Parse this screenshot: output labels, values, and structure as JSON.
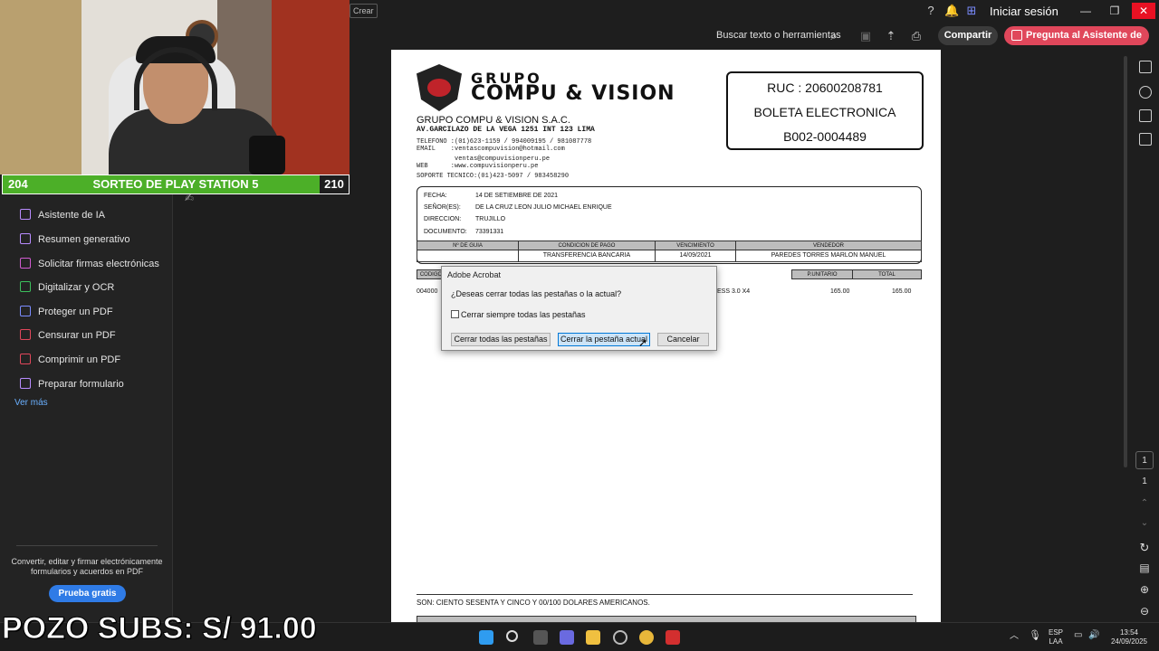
{
  "app": {
    "crear_label": "Crear",
    "signin_label": "Iniciar sesión",
    "search_label": "Buscar texto o herramientas",
    "share_label": "Compartir",
    "ai_button_label": "Pregunta al Asistente de IA",
    "window_controls": {
      "minimize": "—",
      "restore": "❐",
      "close": "✕"
    }
  },
  "stream": {
    "left_number": "204",
    "title": "SORTEO DE PLAY STATION 5",
    "right_number": "210",
    "subs_text": "POZO SUBS: S/ 91.00",
    "accent_color": "#4caf28"
  },
  "sidebar": {
    "items": [
      {
        "label": "Asistente de IA",
        "icon": "ai-assistant-icon",
        "color": "#b98cff"
      },
      {
        "label": "Resumen generativo",
        "icon": "summary-icon",
        "color": "#b98cff"
      },
      {
        "label": "Solicitar firmas electrónicas",
        "icon": "signature-icon",
        "color": "#d05bd0"
      },
      {
        "label": "Digitalizar y OCR",
        "icon": "scan-icon",
        "color": "#3cbf5c"
      },
      {
        "label": "Proteger un PDF",
        "icon": "protect-icon",
        "color": "#7b8cff"
      },
      {
        "label": "Censurar un PDF",
        "icon": "redact-icon",
        "color": "#e0475b"
      },
      {
        "label": "Comprimir un PDF",
        "icon": "compress-icon",
        "color": "#e0475b"
      },
      {
        "label": "Preparar formulario",
        "icon": "form-icon",
        "color": "#b98cff"
      }
    ],
    "more_label": "Ver más",
    "promo_text": "Convertir, editar y firmar electrónicamente formularios y acuerdos en PDF",
    "trial_label": "Prueba gratis"
  },
  "document": {
    "logo_top": "GRUPO",
    "logo_name": "COMPU & VISION",
    "company": "GRUPO COMPU & VISION S.A.C.",
    "address": "AV.GARCILAZO DE LA VEGA 1251 INT 123 LIMA",
    "telefono": "TELEFONO :(01)623-1159 / 994009195 / 981087778",
    "email": "EMAIL    :ventascompuvision@hotmail.com",
    "email2": "          ventas@compuvisionperu.pe",
    "web": "WEB      :www.compuvisionperu.pe",
    "soporte": "SOPORTE TECNICO:(01)423-5097 / 983458290",
    "ruc": "RUC : 20600208781",
    "doc_type": "BOLETA ELECTRONICA",
    "doc_number": "B002-0004489",
    "fields": [
      {
        "label": "FECHA:",
        "value": "14 DE SETIEMBRE DE 2021"
      },
      {
        "label": "SEÑOR(ES):",
        "value": "DE LA CRUZ LEON JULIO MICHAEL ENRIQUE"
      },
      {
        "label": "DIRECCION:",
        "value": "TRUJILLO"
      },
      {
        "label": "DOCUMENTO:",
        "value": "73391331"
      }
    ],
    "table1_headers": [
      "Nº DE GUIA",
      "CONDICION DE PAGO",
      "VENCIMIENTO",
      "VENDEDOR"
    ],
    "table1_values": [
      "",
      "TRANSFERENCIA BANCARIA",
      "14/09/2021",
      "PAREDES TORRES MARLON MANUEL"
    ],
    "table2_headers": [
      "CODIGO",
      "P.UNITARIO",
      "TOTAL"
    ],
    "item_code": "004000",
    "item_desc_tail": "ESS 3.0 X4",
    "item_unit": "165.00",
    "item_total": "165.00",
    "son": "SON: CIENTO SESENTA Y CINCO Y 00/100 DOLARES AMERICANOS."
  },
  "dialog": {
    "title": "Adobe Acrobat",
    "message": "¿Deseas cerrar todas las pestañas o la actual?",
    "checkbox_label": "Cerrar siempre todas las pestañas",
    "btn_close_all": "Cerrar todas las pestañas",
    "btn_close_current": "Cerrar la pestaña actual",
    "btn_cancel": "Cancelar"
  },
  "rightrail": {
    "page_current": "1",
    "page_total": "1"
  },
  "taskbar": {
    "lang1": "ESP",
    "lang2": "LAA",
    "time": "13:54",
    "date": "24/09/2025"
  }
}
